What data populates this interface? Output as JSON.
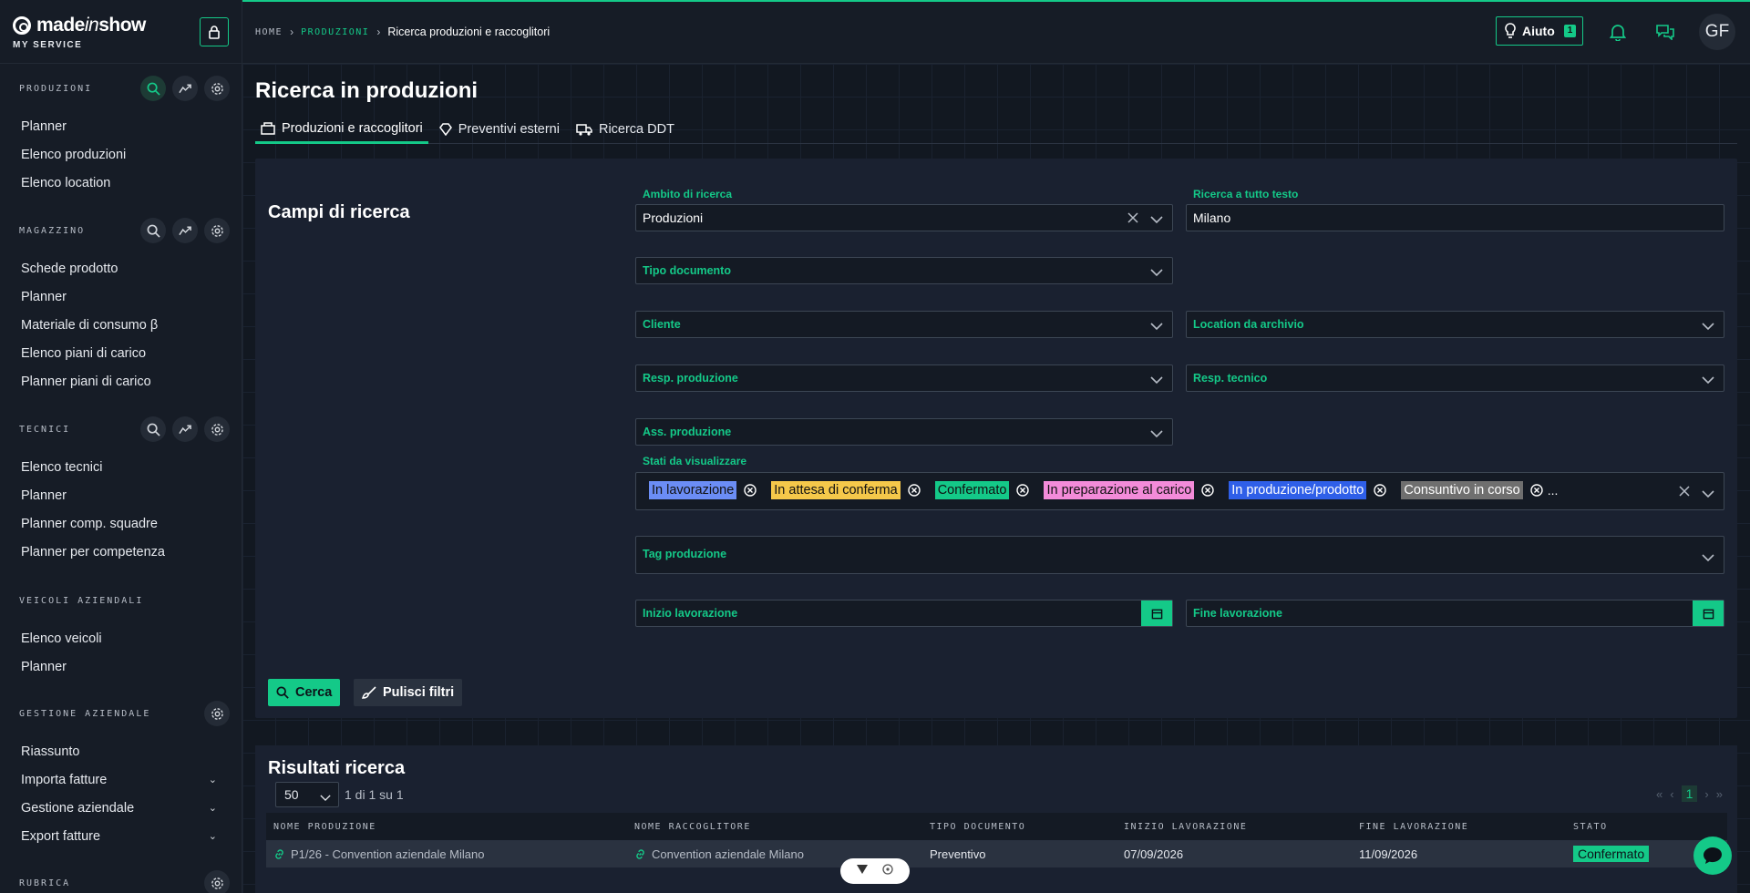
{
  "brand": {
    "name_a": "made",
    "name_b": "in",
    "name_c": "show",
    "subtitle": "MY SERVICE"
  },
  "colors": {
    "accent": "#14c988",
    "bg": "#141a24"
  },
  "sidebar": {
    "sections": [
      {
        "title": "PRODUZIONI",
        "items": [
          "Planner",
          "Elenco produzioni",
          "Elenco location"
        ]
      },
      {
        "title": "MAGAZZINO",
        "items": [
          "Schede prodotto",
          "Planner",
          "Materiale di consumo β",
          "Elenco piani di carico",
          "Planner piani di carico"
        ]
      },
      {
        "title": "TECNICI",
        "items": [
          "Elenco tecnici",
          "Planner",
          "Planner comp. squadre",
          "Planner per competenza"
        ]
      },
      {
        "title": "VEICOLI AZIENDALI",
        "items": [
          "Elenco veicoli",
          "Planner"
        ]
      },
      {
        "title": "GESTIONE AZIENDALE",
        "items": [
          "Riassunto",
          "Importa fatture",
          "Gestione aziendale",
          "Export fatture"
        ]
      },
      {
        "title": "RUBRICA",
        "items": []
      }
    ]
  },
  "header": {
    "breadcrumb": {
      "home": "HOME",
      "section": "PRODUZIONI",
      "current": "Ricerca produzioni e raccoglitori"
    },
    "help_label": "Aiuto",
    "help_count": "1",
    "avatar": "GF"
  },
  "main": {
    "title": "Ricerca in produzioni",
    "tabs": [
      "Produzioni e raccoglitori",
      "Preventivi esterni",
      "Ricerca DDT"
    ],
    "search_panel": {
      "title": "Campi di ricerca",
      "ambito_label": "Ambito di ricerca",
      "ambito_value": "Produzioni",
      "fulltext_label": "Ricerca a tutto testo",
      "fulltext_value": "Milano",
      "tipo_documento": "Tipo documento",
      "cliente": "Cliente",
      "location_archivio": "Location da archivio",
      "resp_produzione": "Resp. produzione",
      "resp_tecnico": "Resp. tecnico",
      "ass_produzione": "Ass. produzione",
      "stati_label": "Stati da visualizzare",
      "stati": [
        {
          "label": "In lavorazione",
          "color": "#6b8df5"
        },
        {
          "label": "In attesa di conferma",
          "color": "#f5c84a"
        },
        {
          "label": "Confermato",
          "color": "#14c988"
        },
        {
          "label": "In preparazione al carico",
          "color": "#f38bd9"
        },
        {
          "label": "In produzione/prodotto",
          "color": "#2f5fe8"
        },
        {
          "label": "Consuntivo in corso",
          "color": "#6f6f6f"
        }
      ],
      "stati_more": "...",
      "tag_produzione": "Tag produzione",
      "inizio_lavorazione": "Inizio lavorazione",
      "fine_lavorazione": "Fine lavorazione",
      "search_btn": "Cerca",
      "clear_btn": "Pulisci filtri"
    },
    "results": {
      "title": "Risultati ricerca",
      "page_size": "50",
      "page_info": "1 di 1 su 1",
      "current_page": "1",
      "columns": [
        "NOME PRODUZIONE",
        "NOME RACCOGLITORE",
        "TIPO DOCUMENTO",
        "INIZIO LAVORAZIONE",
        "FINE LAVORAZIONE",
        "STATO"
      ],
      "rows": [
        {
          "produzione": "P1/26 - Convention aziendale Milano",
          "raccoglitore": "Convention aziendale Milano",
          "tipo": "Preventivo",
          "inizio": "07/09/2026",
          "fine": "11/09/2026",
          "stato": "Confermato"
        }
      ]
    }
  }
}
